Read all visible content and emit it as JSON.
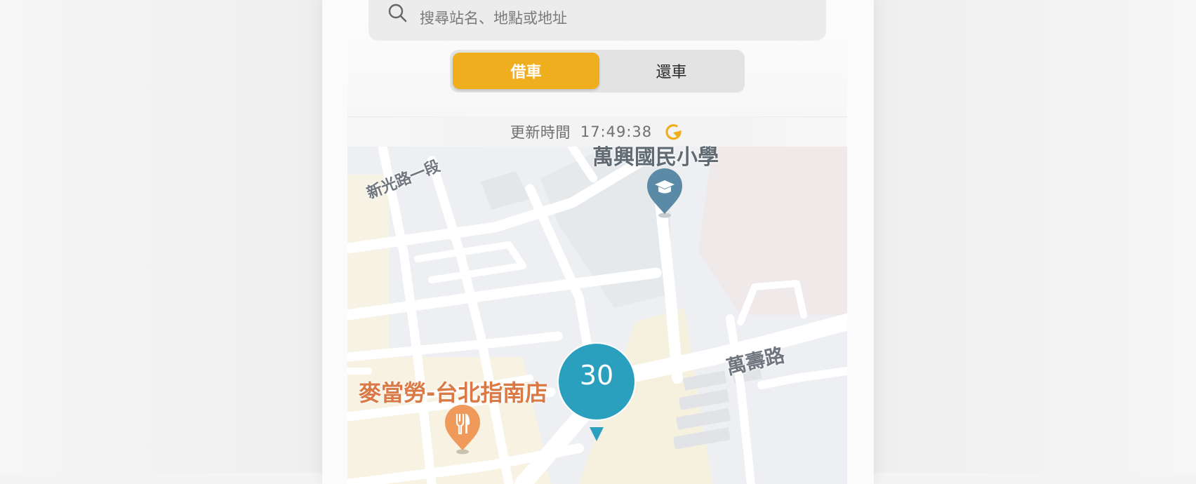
{
  "search": {
    "placeholder": "搜尋站名、地點或地址",
    "icon": "search-icon"
  },
  "mode_toggle": {
    "borrow_label": "借車",
    "return_label": "還車",
    "selected": "borrow",
    "accent_color": "#efae1d"
  },
  "update": {
    "label": "更新時間",
    "time": "17:49:38",
    "refresh_icon": "refresh-icon",
    "refresh_color": "#efae1d"
  },
  "map": {
    "road_labels": [
      "新光路一段",
      "萬壽路"
    ],
    "poi_school": "萬興國民小學",
    "poi_food": "麥當勞-台北指南店",
    "station_count": "30",
    "station_color": "#2b9fbe"
  }
}
